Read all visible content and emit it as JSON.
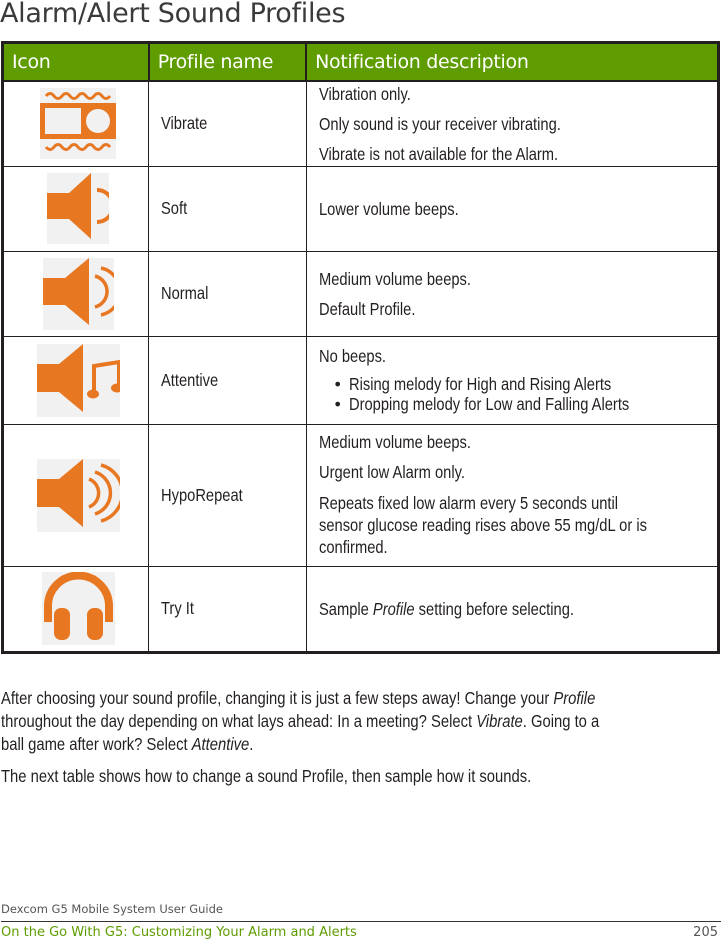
{
  "page": {
    "title": "Alarm/Alert Sound Profiles"
  },
  "table": {
    "headers": [
      "Icon",
      "Profile name",
      "Notification description"
    ],
    "icon_color": "#e87722",
    "header_color": "#5e9c00",
    "rows": [
      {
        "icon": "vibrate-icon",
        "name": "Vibrate",
        "desc": [
          "Vibration only.",
          "Only sound is your receiver vibrating.",
          "Vibrate is not available for the Alarm."
        ]
      },
      {
        "icon": "speaker-soft-icon",
        "name": "Soft",
        "desc": [
          "Lower volume beeps."
        ]
      },
      {
        "icon": "speaker-normal-icon",
        "name": "Normal",
        "desc": [
          "Medium volume beeps.",
          "Default Profile."
        ]
      },
      {
        "icon": "speaker-music-icon",
        "name": "Attentive",
        "desc": [
          "No beeps."
        ],
        "bullets": [
          "Rising melody for High and Rising Alerts",
          "Dropping melody for Low and Falling Alerts"
        ]
      },
      {
        "icon": "speaker-loud-icon",
        "name": "HypoRepeat",
        "desc": [
          "Medium volume beeps.",
          "Urgent low Alarm only.",
          "Repeats fixed low alarm every 5 seconds until",
          "sensor glucose reading rises above 55 mg/dL or is",
          "confirmed."
        ]
      },
      {
        "icon": "headphones-icon",
        "name": "Try It",
        "desc_prefix": "Sample ",
        "desc_italic": "Profile",
        "desc_suffix": " setting before selecting."
      }
    ]
  },
  "body": {
    "p1_line1_a": "After choosing your sound profile, changing it is just a few steps away! Change your ",
    "p1_line1_i": "Profile",
    "p1_line2_a": "throughout the day depending on what lays ahead: In a meeting? Select ",
    "p1_line2_i": "Vibrate",
    "p1_line2_b": ". Going to a",
    "p1_line3_a": "ball game after work? Select ",
    "p1_line3_i": "Attentive",
    "p1_line3_b": ".",
    "p2": "The next table shows how to change a sound Profile, then sample how it sounds."
  },
  "footer": {
    "guide": "Dexcom G5 Mobile System User Guide",
    "chapter": "On the Go With G5: Customizing Your Alarm and Alerts",
    "page_number": "205"
  }
}
